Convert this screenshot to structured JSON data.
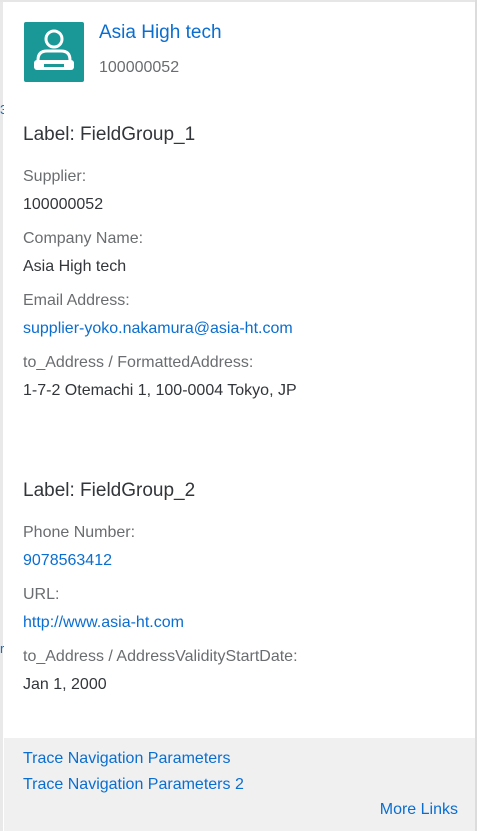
{
  "background_fragments": {
    "frag_top": "3",
    "frag_bottom": "r"
  },
  "header": {
    "title": "Asia High tech",
    "subtitle": "100000052",
    "avatar_icon": "person-icon",
    "avatar_color": "#1a9898"
  },
  "group1": {
    "title": "Label: FieldGroup_1",
    "fields": [
      {
        "label": "Supplier:",
        "value": "100000052"
      },
      {
        "label": "Company Name:",
        "value": "Asia High tech"
      },
      {
        "label": "Email Address:",
        "value": "supplier-yoko.nakamura@asia-ht.com"
      },
      {
        "label": "to_Address / FormattedAddress:",
        "value": "1-7-2 Otemachi 1, 100-0004 Tokyo, JP"
      }
    ]
  },
  "group2": {
    "title": "Label: FieldGroup_2",
    "fields": [
      {
        "label": "Phone Number:",
        "value": "9078563412"
      },
      {
        "label": "URL:",
        "value": "http://www.asia-ht.com"
      },
      {
        "label": "to_Address / AddressValidityStartDate:",
        "value": "Jan 1, 2000"
      }
    ]
  },
  "footer": {
    "links": [
      "Trace Navigation Parameters",
      "Trace Navigation Parameters 2"
    ],
    "more_links": "More Links"
  },
  "colors": {
    "link": "#0a6ed1",
    "text": "#32363a",
    "label": "#6a6d70",
    "footer_bg": "#f0f0f0"
  }
}
